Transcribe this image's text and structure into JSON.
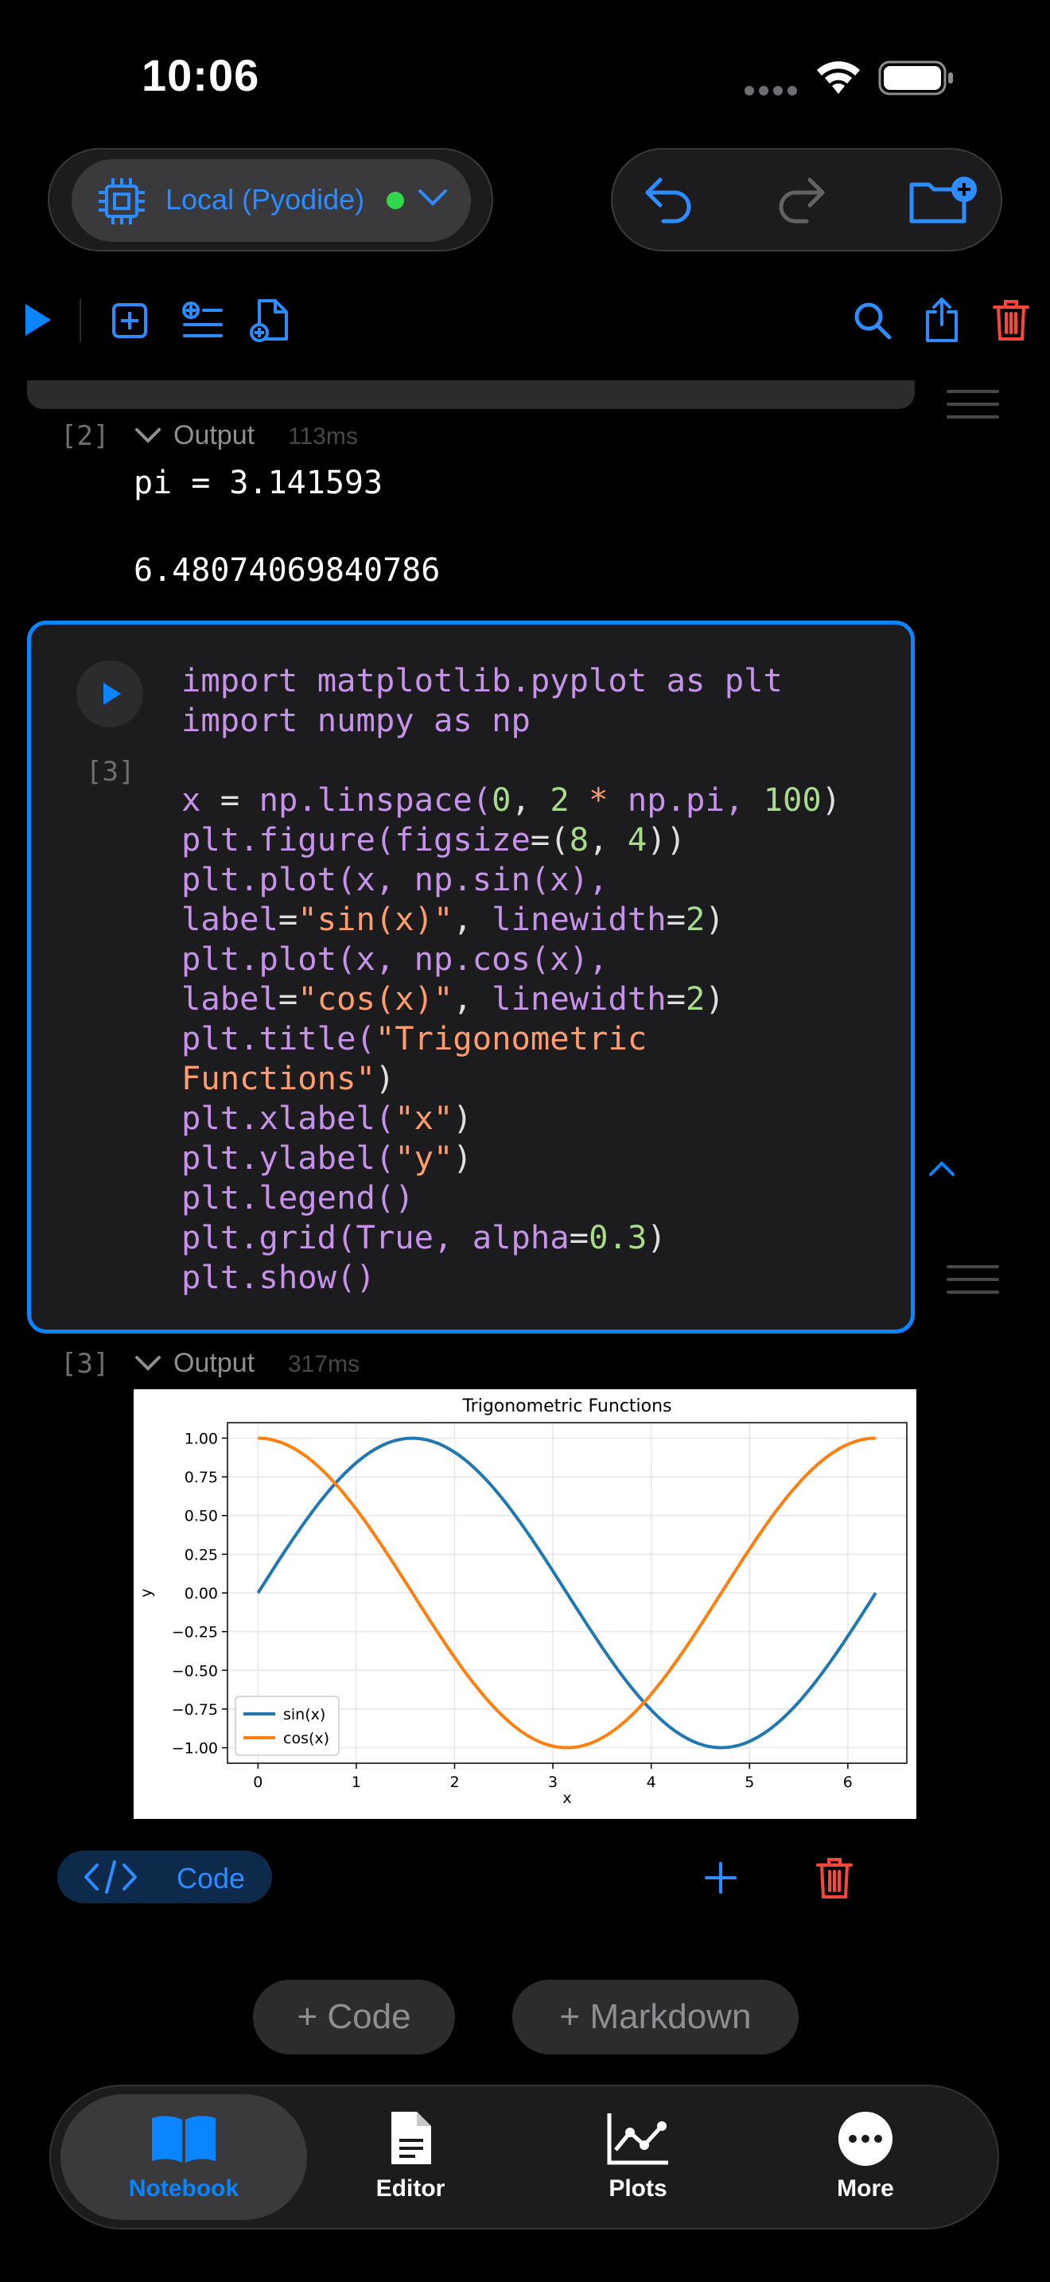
{
  "status_bar": {
    "time": "10:06"
  },
  "kernel": {
    "label": "Local (Pyodide)"
  },
  "cell2_output": {
    "exec_count": "[2]",
    "label": "Output",
    "time": "113ms",
    "lines": [
      "pi = 3.141593",
      "",
      "6.48074069840786"
    ]
  },
  "cell3": {
    "exec_count": "[3]",
    "code": [
      [
        [
          "import ",
          "kw"
        ],
        [
          "matplotlib.pyplot ",
          "kw"
        ],
        [
          "as ",
          "kw"
        ],
        [
          "plt",
          "kw"
        ]
      ],
      [
        [
          "import ",
          "kw"
        ],
        [
          "numpy ",
          "kw"
        ],
        [
          "as ",
          "kw"
        ],
        [
          "np",
          "kw"
        ]
      ],
      [],
      [
        [
          "x ",
          "kw"
        ],
        [
          "= ",
          "op"
        ],
        [
          "np.linspace(",
          "kw"
        ],
        [
          "0",
          "num"
        ],
        [
          ", ",
          "op"
        ],
        [
          "2 ",
          "num"
        ],
        [
          "* ",
          "str"
        ],
        [
          "np.pi, ",
          "kw"
        ],
        [
          "100",
          "num"
        ],
        [
          ")",
          "op"
        ]
      ],
      [
        [
          "plt.figure(figsize",
          "kw"
        ],
        [
          "=(",
          "op"
        ],
        [
          "8",
          "num"
        ],
        [
          ", ",
          "op"
        ],
        [
          "4",
          "num"
        ],
        [
          "))",
          "op"
        ]
      ],
      [
        [
          "plt.plot(x, np.sin(x),",
          "kw"
        ]
      ],
      [
        [
          "label",
          "kw"
        ],
        [
          "=",
          "op"
        ],
        [
          "\"sin(x)\"",
          "str"
        ],
        [
          ", ",
          "op"
        ],
        [
          "linewidth",
          "kw"
        ],
        [
          "=",
          "op"
        ],
        [
          "2",
          "num"
        ],
        [
          ")",
          "op"
        ]
      ],
      [
        [
          "plt.plot(x, np.cos(x),",
          "kw"
        ]
      ],
      [
        [
          "label",
          "kw"
        ],
        [
          "=",
          "op"
        ],
        [
          "\"cos(x)\"",
          "str"
        ],
        [
          ", ",
          "op"
        ],
        [
          "linewidth",
          "kw"
        ],
        [
          "=",
          "op"
        ],
        [
          "2",
          "num"
        ],
        [
          ")",
          "op"
        ]
      ],
      [
        [
          "plt.title(",
          "kw"
        ],
        [
          "\"Trigonometric",
          "str"
        ]
      ],
      [
        [
          "Functions\"",
          "str"
        ],
        [
          ")",
          "op"
        ]
      ],
      [
        [
          "plt.xlabel(",
          "kw"
        ],
        [
          "\"x\"",
          "str"
        ],
        [
          ")",
          "op"
        ]
      ],
      [
        [
          "plt.ylabel(",
          "kw"
        ],
        [
          "\"y\"",
          "str"
        ],
        [
          ")",
          "op"
        ]
      ],
      [
        [
          "plt.legend()",
          "kw"
        ]
      ],
      [
        [
          "plt.grid(True, alpha",
          "kw"
        ],
        [
          "=",
          "op"
        ],
        [
          "0.3",
          "num"
        ],
        [
          ")",
          "op"
        ]
      ],
      [
        [
          "plt.show()",
          "kw"
        ]
      ]
    ]
  },
  "cell3_output": {
    "exec_count": "[3]",
    "label": "Output",
    "time": "317ms"
  },
  "chart_data": {
    "type": "line",
    "title": "Trigonometric Functions",
    "xlabel": "x",
    "ylabel": "y",
    "xlim": [
      -0.31,
      6.6
    ],
    "ylim": [
      -1.1,
      1.1
    ],
    "xticks": [
      "0",
      "1",
      "2",
      "3",
      "4",
      "5",
      "6"
    ],
    "yticks": [
      "1.00",
      "0.75",
      "0.50",
      "0.25",
      "0.00",
      "−0.25",
      "−0.50",
      "−0.75",
      "−1.00"
    ],
    "grid": true,
    "legend_position": "lower-left",
    "series": [
      {
        "name": "sin(x)",
        "function": "sin",
        "x_range": [
          0,
          6.283
        ],
        "points": 100,
        "color": "#1f77b4"
      },
      {
        "name": "cos(x)",
        "function": "cos",
        "x_range": [
          0,
          6.283
        ],
        "points": 100,
        "color": "#ff7f0e"
      }
    ]
  },
  "cell_toolbar": {
    "type_label": "Code"
  },
  "add_buttons": {
    "code": "+ Code",
    "markdown": "+ Markdown"
  },
  "tabs": [
    {
      "label": "Notebook",
      "icon": "book-icon",
      "active": true
    },
    {
      "label": "Editor",
      "icon": "document-icon",
      "active": false
    },
    {
      "label": "Plots",
      "icon": "chart-icon",
      "active": false
    },
    {
      "label": "More",
      "icon": "ellipsis-icon",
      "active": false
    }
  ],
  "colors": {
    "accent": "#0a84ff",
    "danger": "#ff453a",
    "status_ok": "#32d74b"
  }
}
